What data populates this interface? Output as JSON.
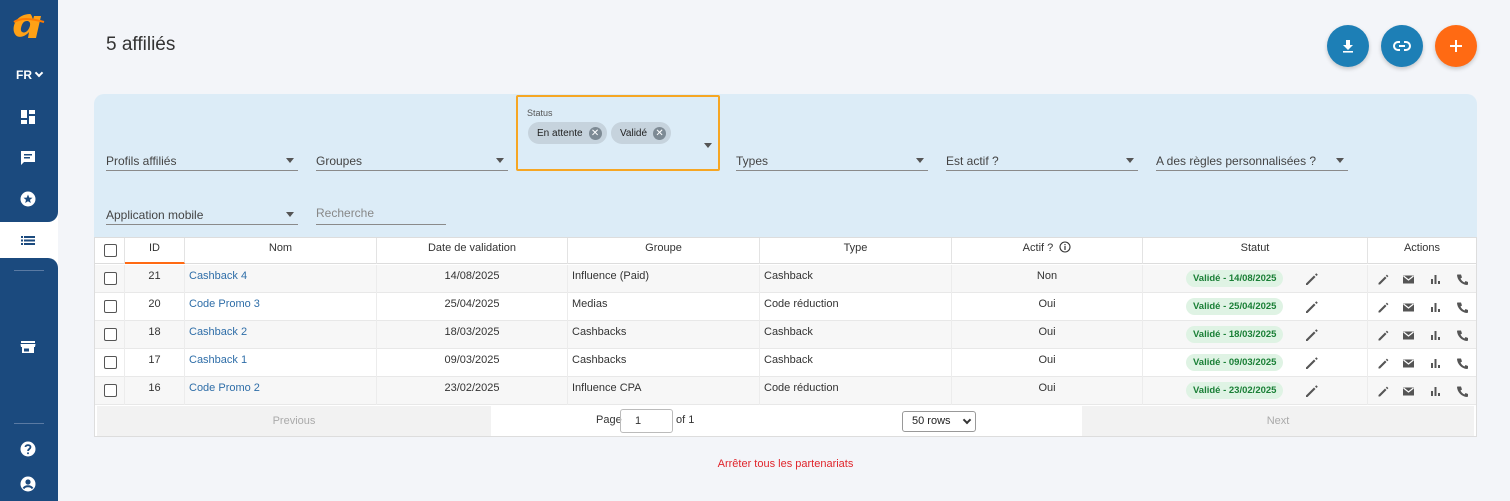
{
  "sidebar": {
    "language": "FR",
    "icons": [
      "dashboard-icon",
      "chat-icon",
      "star-icon",
      "list-icon",
      "store-icon",
      "help-icon",
      "account-icon"
    ]
  },
  "header": {
    "title": "5 affiliés",
    "actions": [
      "download-icon",
      "link-icon",
      "plus-icon"
    ]
  },
  "filters": {
    "profils": "Profils affiliés",
    "groupes": "Groupes",
    "status_label": "Status",
    "status_chips": [
      "En attente",
      "Validé"
    ],
    "types": "Types",
    "est_actif": "Est actif ?",
    "regles": "A des règles personnalisées ?",
    "application": "Application mobile",
    "search_placeholder": "Recherche"
  },
  "table": {
    "headers": {
      "id": "ID",
      "nom": "Nom",
      "date": "Date de validation",
      "groupe": "Groupe",
      "type": "Type",
      "actif": "Actif ?",
      "statut": "Statut",
      "actions": "Actions"
    },
    "rows": [
      {
        "id": "21",
        "nom": "Cashback 4",
        "date": "14/08/2025",
        "groupe": "Influence (Paid)",
        "type": "Cashback",
        "actif": "Non",
        "statut": "Validé - 14/08/2025"
      },
      {
        "id": "20",
        "nom": "Code Promo 3",
        "date": "25/04/2025",
        "groupe": "Medias",
        "type": "Code réduction",
        "actif": "Oui",
        "statut": "Validé - 25/04/2025"
      },
      {
        "id": "18",
        "nom": "Cashback 2",
        "date": "18/03/2025",
        "groupe": "Cashbacks",
        "type": "Cashback",
        "actif": "Oui",
        "statut": "Validé - 18/03/2025"
      },
      {
        "id": "17",
        "nom": "Cashback 1",
        "date": "09/03/2025",
        "groupe": "Cashbacks",
        "type": "Cashback",
        "actif": "Oui",
        "statut": "Validé - 09/03/2025"
      },
      {
        "id": "16",
        "nom": "Code Promo 2",
        "date": "23/02/2025",
        "groupe": "Influence CPA",
        "type": "Code réduction",
        "actif": "Oui",
        "statut": "Validé - 23/02/2025"
      }
    ]
  },
  "pagination": {
    "previous": "Previous",
    "page_label": "Page",
    "page_value": "1",
    "of_label": "of 1",
    "rows_option": "50 rows",
    "next": "Next"
  },
  "footer": {
    "stop_link": "Arrêter tous les partenariats"
  },
  "colors": {
    "sidebar": "#1b4a7e",
    "accent_blue": "#1d7fb6",
    "accent_orange": "#ff6a13",
    "focus_border": "#f6a623",
    "badge_bg": "#dff3e4",
    "badge_text": "#1a7f36",
    "danger": "#e0252c"
  }
}
